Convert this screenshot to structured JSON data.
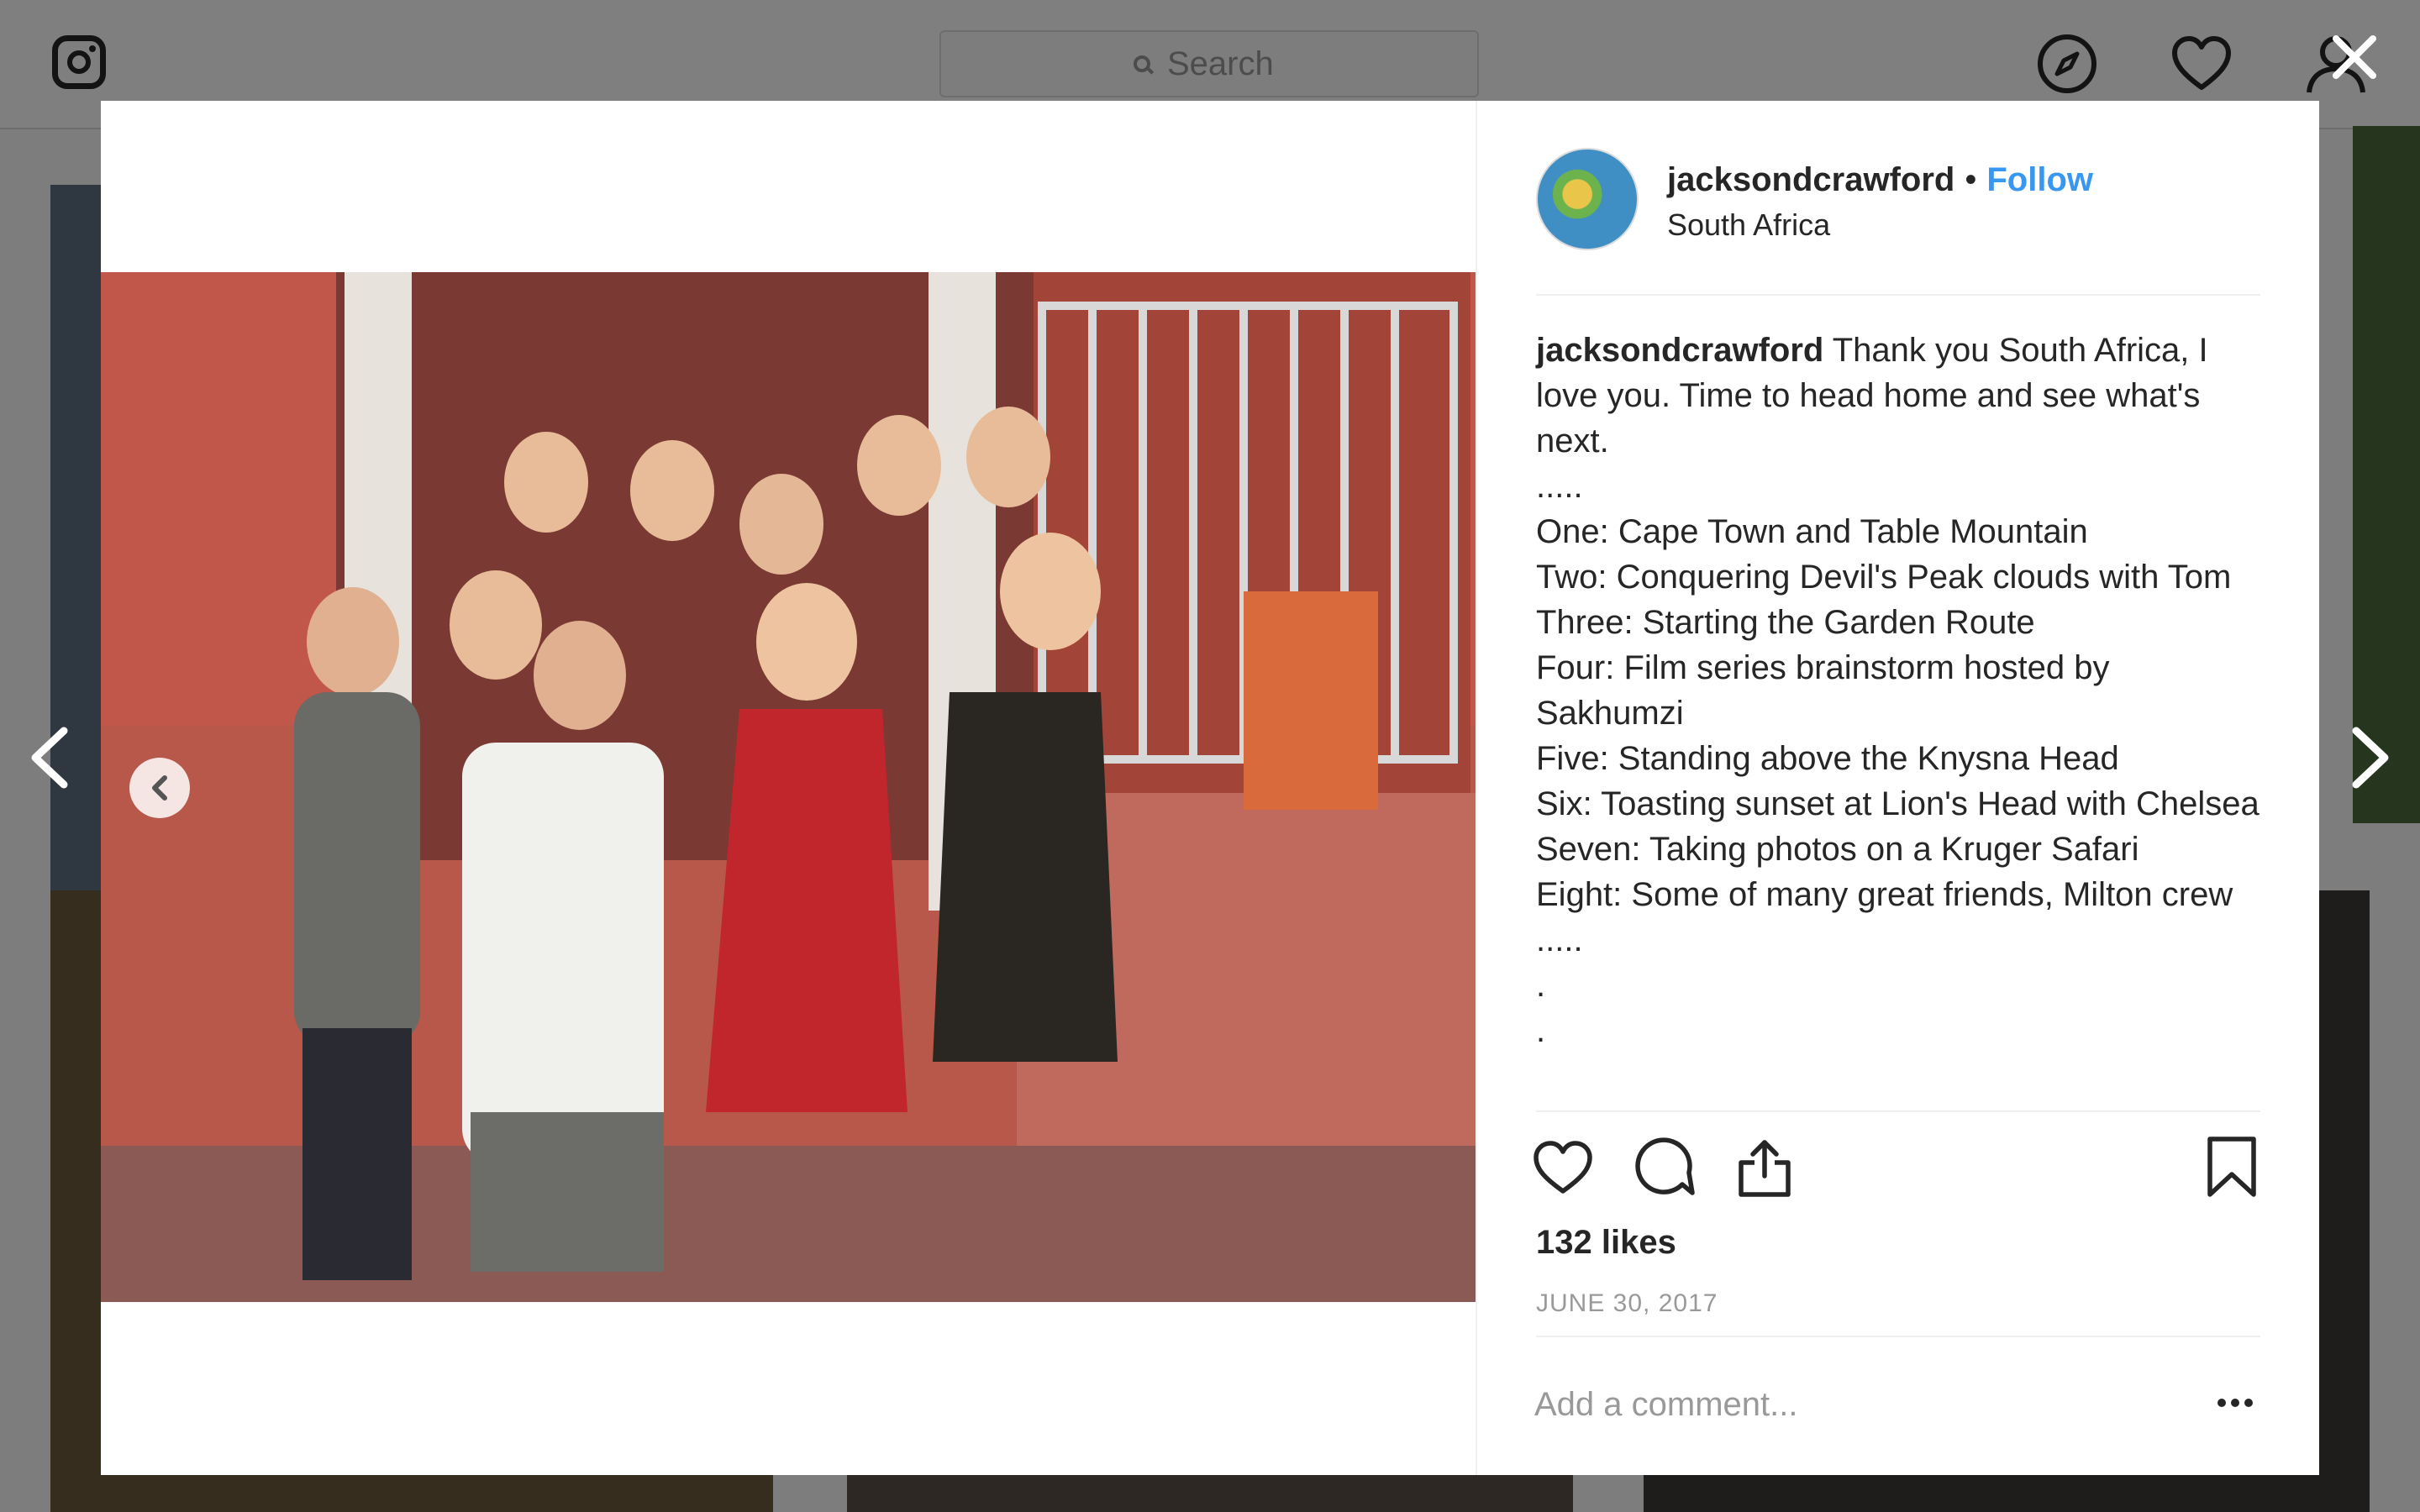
{
  "search": {
    "placeholder": "Search"
  },
  "post": {
    "username": "jacksondcrawford",
    "bullet": "•",
    "follow_label": "Follow",
    "location": "South Africa",
    "caption": {
      "username": "jacksondcrawford",
      "lines": [
        "Thank you South Africa, I love you. Time to head home and see what's next.",
        ".....",
        "One: Cape Town and Table Mountain",
        "Two: Conquering Devil's Peak clouds with Tom",
        "Three: Starting the Garden Route",
        "Four: Film series brainstorm hosted by Sakhumzi",
        "Five: Standing above the Knysna Head",
        "Six: Toasting sunset at Lion's Head with Chelsea",
        "Seven: Taking photos on a Kruger Safari",
        "Eight: Some of many great friends, Milton crew",
        ".....",
        ".",
        "."
      ]
    },
    "likes": "132 likes",
    "date": "JUNE 30, 2017",
    "comment_placeholder": "Add a comment..."
  },
  "icons": {
    "nav": [
      "instagram-icon",
      "explore-icon",
      "heart-icon",
      "profile-icon"
    ],
    "actions": [
      "like-icon",
      "comment-icon",
      "share-icon",
      "bookmark-icon"
    ],
    "modal": [
      "close-icon",
      "chevron-left-icon",
      "chevron-right-icon",
      "more-options-icon"
    ]
  },
  "colors": {
    "link": "#3897f0",
    "text": "#262626",
    "muted": "#999999",
    "overlay": "rgba(0,0,0,0.5)"
  }
}
